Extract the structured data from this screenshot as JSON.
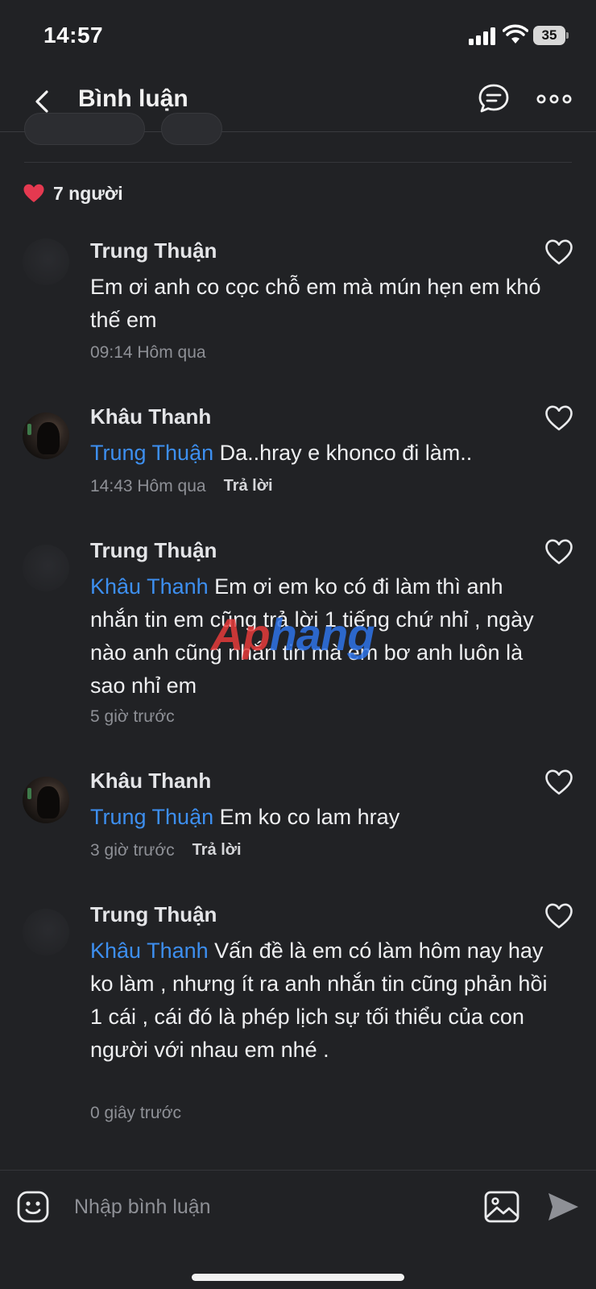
{
  "status_bar": {
    "time": "14:57",
    "battery": "35",
    "icons": [
      "signal-icon",
      "wifi-icon",
      "battery-icon"
    ]
  },
  "header": {
    "title": "Bình luận",
    "back_icon": "chevron-left-icon",
    "chat_icon": "chat-bubble-icon",
    "more_icon": "more-dots-icon"
  },
  "likes": {
    "icon": "heart-filled-icon",
    "text": "7 người",
    "color": "#e53950"
  },
  "comments": [
    {
      "author": "Trung Thuận",
      "mention": "",
      "text": "Em ơi anh co cọc chỗ em mà mún hẹn em khó thế em",
      "time": "09:14 Hôm qua",
      "reply": ""
    },
    {
      "author": "Khâu Thanh",
      "mention": "Trung Thuận",
      "text": "Da..hray e khonco đi làm..",
      "time": "14:43 Hôm qua",
      "reply": "Trả lời"
    },
    {
      "author": "Trung Thuận",
      "mention": "Khâu Thanh",
      "text": "Em ơi em ko có đi làm thì anh nhắn tin em cũng trả lời 1 tiếng chứ nhỉ , ngày nào anh cũng nhắn tin mà em bơ anh luôn là sao nhỉ em",
      "time": "5 giờ trước",
      "reply": ""
    },
    {
      "author": "Khâu Thanh",
      "mention": "Trung Thuận",
      "text": "Em ko co lam hray",
      "time": "3 giờ trước",
      "reply": "Trả lời"
    },
    {
      "author": "Trung Thuận",
      "mention": "Khâu Thanh",
      "text": "Vấn đề là em có làm hôm nay hay ko làm , nhưng ít ra anh nhắn tin cũng phản hồi 1 cái , cái đó là phép lịch sự tối thiểu của con người với nhau em nhé .",
      "time": "0 giây trước",
      "reply": ""
    }
  ],
  "watermark": {
    "part1": "Ap",
    "part2": "hang"
  },
  "input_bar": {
    "placeholder": "Nhập bình luận",
    "icons": [
      "emoji-icon",
      "image-icon",
      "send-icon"
    ]
  },
  "colors": {
    "background": "#212225",
    "mention": "#3d8ff0",
    "meta": "#8e9096"
  }
}
